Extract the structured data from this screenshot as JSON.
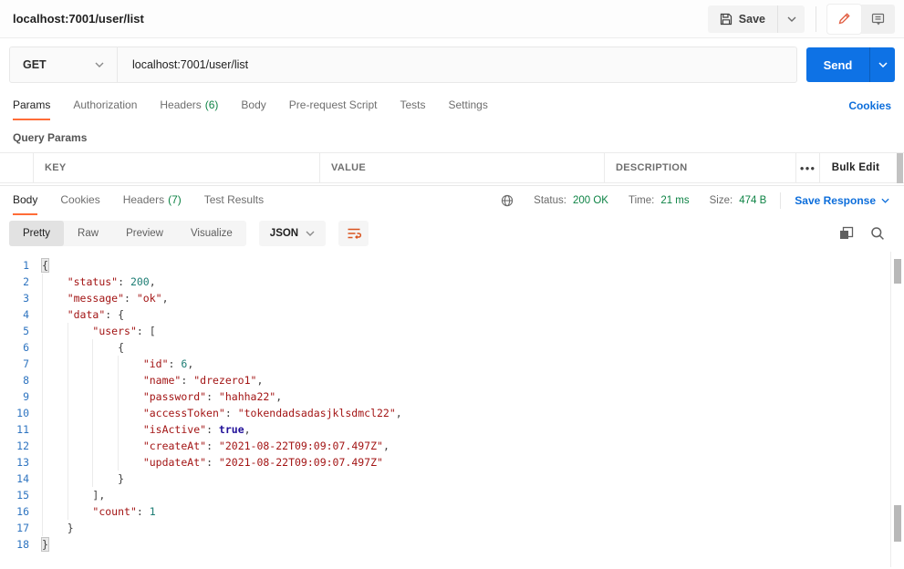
{
  "colors": {
    "accent_orange": "#ff6c37",
    "send_blue": "#0e72e5",
    "link_blue": "#0d6edb",
    "success_green": "#0e8345",
    "code_key": "#a31515",
    "code_string": "#a31515",
    "code_number": "#1d7d74",
    "code_boolean": "#221199",
    "line_number_blue": "#2e74c0"
  },
  "header": {
    "title": "localhost:7001/user/list",
    "save_label": "Save"
  },
  "request": {
    "method": "GET",
    "url": "localhost:7001/user/list",
    "send_label": "Send",
    "tabs": [
      {
        "label": "Params",
        "active": true
      },
      {
        "label": "Authorization"
      },
      {
        "label": "Headers",
        "count": "(6)"
      },
      {
        "label": "Body"
      },
      {
        "label": "Pre-request Script"
      },
      {
        "label": "Tests"
      },
      {
        "label": "Settings"
      }
    ],
    "cookies_link": "Cookies",
    "query_params": {
      "section_title": "Query Params",
      "columns": {
        "key": "KEY",
        "value": "VALUE",
        "description": "DESCRIPTION"
      },
      "more_glyph": "●●●",
      "bulk_edit_label": "Bulk Edit"
    }
  },
  "response": {
    "tabs": [
      {
        "label": "Body",
        "active": true
      },
      {
        "label": "Cookies"
      },
      {
        "label": "Headers",
        "count": "(7)"
      },
      {
        "label": "Test Results"
      }
    ],
    "meta": {
      "status_label": "Status:",
      "status_value": "200 OK",
      "time_label": "Time:",
      "time_value": "21 ms",
      "size_label": "Size:",
      "size_value": "474 B",
      "save_response_label": "Save Response"
    },
    "view_tabs": [
      {
        "label": "Pretty",
        "active": true
      },
      {
        "label": "Raw"
      },
      {
        "label": "Preview"
      },
      {
        "label": "Visualize"
      }
    ],
    "format": "JSON",
    "code": {
      "lines": [
        {
          "n": 1,
          "indent": 0,
          "tokens": [
            [
              "brace-hl",
              "{"
            ]
          ]
        },
        {
          "n": 2,
          "indent": 1,
          "tokens": [
            [
              "key",
              "\"status\""
            ],
            [
              "punct",
              ": "
            ],
            [
              "num",
              "200"
            ],
            [
              "punct",
              ","
            ]
          ]
        },
        {
          "n": 3,
          "indent": 1,
          "tokens": [
            [
              "key",
              "\"message\""
            ],
            [
              "punct",
              ": "
            ],
            [
              "str",
              "\"ok\""
            ],
            [
              "punct",
              ","
            ]
          ]
        },
        {
          "n": 4,
          "indent": 1,
          "tokens": [
            [
              "key",
              "\"data\""
            ],
            [
              "punct",
              ": {"
            ]
          ]
        },
        {
          "n": 5,
          "indent": 2,
          "tokens": [
            [
              "key",
              "\"users\""
            ],
            [
              "punct",
              ": ["
            ]
          ]
        },
        {
          "n": 6,
          "indent": 3,
          "tokens": [
            [
              "punct",
              "{"
            ]
          ]
        },
        {
          "n": 7,
          "indent": 4,
          "tokens": [
            [
              "key",
              "\"id\""
            ],
            [
              "punct",
              ": "
            ],
            [
              "num",
              "6"
            ],
            [
              "punct",
              ","
            ]
          ]
        },
        {
          "n": 8,
          "indent": 4,
          "tokens": [
            [
              "key",
              "\"name\""
            ],
            [
              "punct",
              ": "
            ],
            [
              "str",
              "\"drezero1\""
            ],
            [
              "punct",
              ","
            ]
          ]
        },
        {
          "n": 9,
          "indent": 4,
          "tokens": [
            [
              "key",
              "\"password\""
            ],
            [
              "punct",
              ": "
            ],
            [
              "str",
              "\"hahha22\""
            ],
            [
              "punct",
              ","
            ]
          ]
        },
        {
          "n": 10,
          "indent": 4,
          "tokens": [
            [
              "key",
              "\"accessToken\""
            ],
            [
              "punct",
              ": "
            ],
            [
              "str",
              "\"tokendadsadasjklsdmcl22\""
            ],
            [
              "punct",
              ","
            ]
          ]
        },
        {
          "n": 11,
          "indent": 4,
          "tokens": [
            [
              "key",
              "\"isActive\""
            ],
            [
              "punct",
              ": "
            ],
            [
              "bool",
              "true"
            ],
            [
              "punct",
              ","
            ]
          ]
        },
        {
          "n": 12,
          "indent": 4,
          "tokens": [
            [
              "key",
              "\"createAt\""
            ],
            [
              "punct",
              ": "
            ],
            [
              "str",
              "\"2021-08-22T09:09:07.497Z\""
            ],
            [
              "punct",
              ","
            ]
          ]
        },
        {
          "n": 13,
          "indent": 4,
          "tokens": [
            [
              "key",
              "\"updateAt\""
            ],
            [
              "punct",
              ": "
            ],
            [
              "str",
              "\"2021-08-22T09:09:07.497Z\""
            ]
          ]
        },
        {
          "n": 14,
          "indent": 3,
          "tokens": [
            [
              "punct",
              "}"
            ]
          ]
        },
        {
          "n": 15,
          "indent": 2,
          "tokens": [
            [
              "punct",
              "],"
            ]
          ]
        },
        {
          "n": 16,
          "indent": 2,
          "tokens": [
            [
              "key",
              "\"count\""
            ],
            [
              "punct",
              ": "
            ],
            [
              "num",
              "1"
            ]
          ]
        },
        {
          "n": 17,
          "indent": 1,
          "tokens": [
            [
              "punct",
              "}"
            ]
          ]
        },
        {
          "n": 18,
          "indent": 0,
          "tokens": [
            [
              "brace-hl",
              "}"
            ]
          ]
        }
      ]
    }
  }
}
